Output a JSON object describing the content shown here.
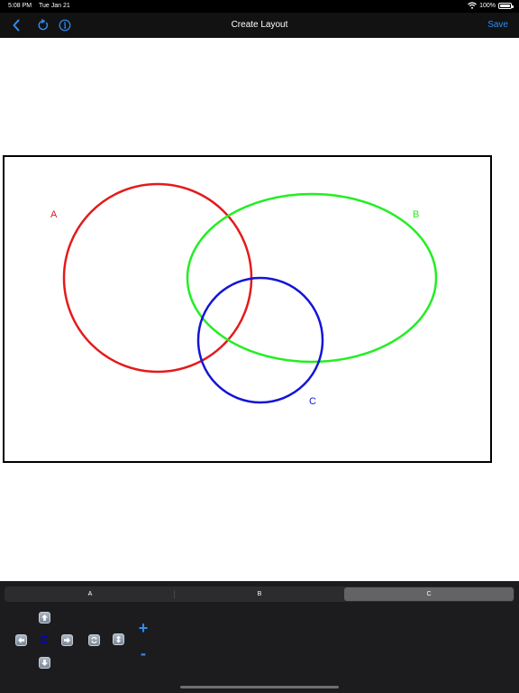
{
  "status_bar": {
    "time": "5:08 PM",
    "date": "Tue Jan 21",
    "battery": "100%",
    "icons": [
      "wifi-icon",
      "battery-icon"
    ]
  },
  "nav": {
    "title": "Create Layout",
    "save_label": "Save",
    "icons": [
      "back-chevron-icon",
      "refresh-icon",
      "info-icon"
    ]
  },
  "venn": {
    "circles": [
      {
        "label": "A",
        "color": "#e31b1b"
      },
      {
        "label": "B",
        "color": "#22ee22"
      },
      {
        "label": "C",
        "color": "#1414d6"
      }
    ],
    "frame_color": "#000000"
  },
  "controls": {
    "segments": [
      "A",
      "B",
      "C"
    ],
    "selected_segment": "C",
    "selected_label": "C",
    "label_color": "#0000d8",
    "buttons": [
      "arrow-up-icon",
      "arrow-left-icon",
      "arrow-right-icon",
      "arrow-down-icon",
      "rotate-icon",
      "stretch-vertical-icon"
    ],
    "zoom_in_label": "+",
    "zoom_out_label": "-"
  },
  "colors": {
    "accent": "#2f8cf4",
    "nav_background": "#121212",
    "panel_background": "#1c1c1e"
  }
}
